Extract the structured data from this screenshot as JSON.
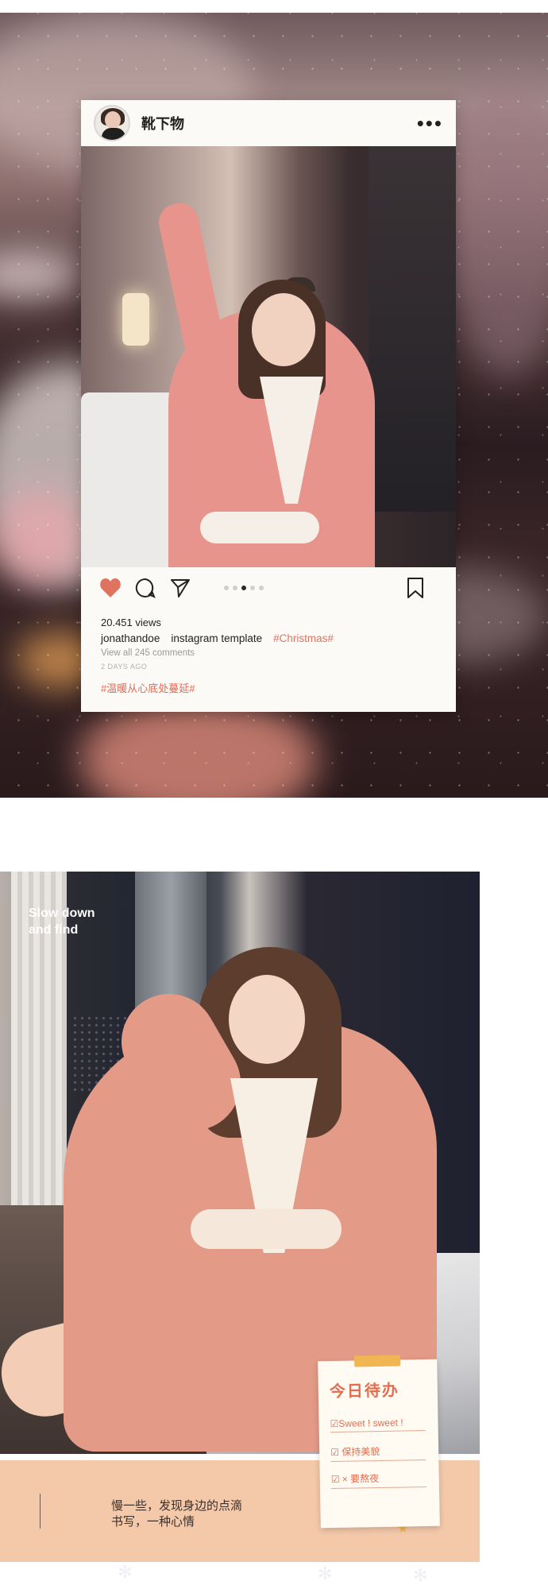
{
  "post": {
    "username": "靴下物",
    "more_icon": "•••",
    "views": "20.451 views",
    "author": "jonathandoe",
    "caption": "instagram template",
    "hashtag": "#Christmas#",
    "comments": "View all 245 comments",
    "time_ago": "2 DAYS AGO",
    "cn_hashtag": "#温暖从心底处蔓延#",
    "carousel_total": 5,
    "carousel_active": 3,
    "like_color": "#e0735f"
  },
  "section2": {
    "slogan_line1": "Slow down",
    "slogan_line2": "and find",
    "band_line1": "慢一些，发现身边的点滴",
    "band_line2": "书写，一种心情",
    "note_title": "今日待办",
    "note_items": [
      "☑Sweet ! sweet !",
      "☑ 保持美貌",
      "☑ × 要熬夜"
    ]
  }
}
